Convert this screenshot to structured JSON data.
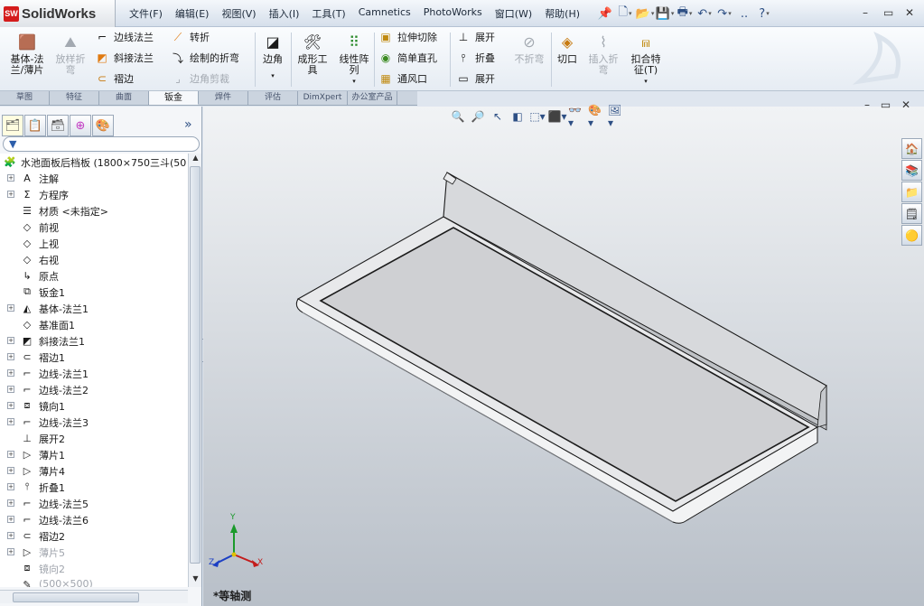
{
  "app": {
    "logo_mark": "SW",
    "logo_text": "SolidWorks"
  },
  "menu": [
    "文件(F)",
    "编辑(E)",
    "视图(V)",
    "插入(I)",
    "工具(T)",
    "Camnetics",
    "PhotoWorks",
    "窗口(W)",
    "帮助(H)"
  ],
  "quick_icons": [
    "pin-icon",
    "new-doc-icon",
    "open-folder-icon",
    "save-icon",
    "print-icon",
    "undo-icon",
    "redo-icon",
    "help-icon"
  ],
  "quick_help": "?",
  "quick_more": "..",
  "window_controls": {
    "minimize": "–",
    "restore": "▭",
    "close": "✕"
  },
  "ribbon": {
    "base_flange": "基体-法\n兰/薄片",
    "lofted_bend": "放样折\n弯",
    "edge_flange": "边线法兰",
    "miter_flange": "斜接法兰",
    "hem": "褶边",
    "jog": "转折",
    "sketched_bend": "绘制的折弯",
    "corner_trim": "边角剪裁",
    "corners": "边角",
    "forming_tool": "成形工\n具",
    "linear_pattern": "线性阵\n列",
    "extruded_cut": "拉伸切除",
    "simple_hole": "简单直孔",
    "vent": "通风口",
    "unfold": "展开",
    "fold": "折叠",
    "flatten": "展开",
    "no_bends": "不折弯",
    "rip": "切口",
    "insert_bends": "插入折\n弯",
    "tab_slot": "扣合特\n征(T)"
  },
  "tabs": [
    {
      "label": "草图",
      "active": false
    },
    {
      "label": "特征",
      "active": false
    },
    {
      "label": "曲面",
      "active": false
    },
    {
      "label": "钣金",
      "active": true
    },
    {
      "label": "焊件",
      "active": false
    },
    {
      "label": "评估",
      "active": false
    },
    {
      "label": "DimXpert",
      "active": false
    },
    {
      "label": "办公室产品",
      "active": false
    }
  ],
  "feature_manager": {
    "chevron": "»",
    "filter_icon": "filter-icon",
    "root": "水池面板后档板  (1800×750三斗(50",
    "nodes": [
      {
        "label": "注解",
        "expandable": true,
        "icon": "annotation-icon",
        "dim": false
      },
      {
        "label": "方程序",
        "expandable": true,
        "icon": "equation-icon",
        "dim": false
      },
      {
        "label": "材质 <未指定>",
        "expandable": false,
        "icon": "material-icon",
        "dim": false
      },
      {
        "label": "前视",
        "expandable": false,
        "icon": "plane-icon",
        "dim": false
      },
      {
        "label": "上视",
        "expandable": false,
        "icon": "plane-icon",
        "dim": false
      },
      {
        "label": "右视",
        "expandable": false,
        "icon": "plane-icon",
        "dim": false
      },
      {
        "label": "原点",
        "expandable": false,
        "icon": "origin-icon",
        "dim": false
      },
      {
        "label": "钣金1",
        "expandable": false,
        "icon": "sheetmetal-icon",
        "dim": false
      },
      {
        "label": "基体-法兰1",
        "expandable": true,
        "icon": "base-flange-icon",
        "dim": false
      },
      {
        "label": "基准面1",
        "expandable": false,
        "icon": "plane-icon",
        "dim": false
      },
      {
        "label": "斜接法兰1",
        "expandable": true,
        "icon": "miter-flange-icon",
        "dim": false
      },
      {
        "label": "褶边1",
        "expandable": true,
        "icon": "hem-icon",
        "dim": false
      },
      {
        "label": "边线-法兰1",
        "expandable": true,
        "icon": "edge-flange-icon",
        "dim": false
      },
      {
        "label": "边线-法兰2",
        "expandable": true,
        "icon": "edge-flange-icon",
        "dim": false
      },
      {
        "label": "镜向1",
        "expandable": true,
        "icon": "mirror-icon",
        "dim": false
      },
      {
        "label": "边线-法兰3",
        "expandable": true,
        "icon": "edge-flange-icon",
        "dim": false
      },
      {
        "label": "展开2",
        "expandable": false,
        "icon": "unfold-icon",
        "dim": false
      },
      {
        "label": "薄片1",
        "expandable": true,
        "icon": "tab-icon",
        "dim": false
      },
      {
        "label": "薄片4",
        "expandable": true,
        "icon": "tab-icon",
        "dim": false
      },
      {
        "label": "折叠1",
        "expandable": true,
        "icon": "fold-icon",
        "dim": false
      },
      {
        "label": "边线-法兰5",
        "expandable": true,
        "icon": "edge-flange-icon",
        "dim": false
      },
      {
        "label": "边线-法兰6",
        "expandable": true,
        "icon": "edge-flange-icon",
        "dim": false
      },
      {
        "label": "褶边2",
        "expandable": true,
        "icon": "hem-icon",
        "dim": false
      },
      {
        "label": "薄片5",
        "expandable": true,
        "icon": "tab-icon",
        "dim": true
      },
      {
        "label": "镜向2",
        "expandable": false,
        "icon": "mirror-icon",
        "dim": true
      },
      {
        "label": "(500×500)",
        "expandable": false,
        "icon": "sketch-icon",
        "dim": true
      }
    ]
  },
  "viewport": {
    "view_name": "*等轴测",
    "axes": {
      "x": "X",
      "y": "Y",
      "z": "Z"
    },
    "view_tool_icons": [
      "zoom-fit-icon",
      "zoom-area-icon",
      "previous-view-icon",
      "section-view-icon",
      "view-orientation-icon",
      "display-style-icon",
      "hide-show-icon",
      "edit-appearance-icon",
      "apply-scene-icon"
    ],
    "task_pane_icons": [
      "home-icon",
      "design-library-icon",
      "file-explorer-icon",
      "view-palette-icon",
      "appearances-icon"
    ]
  },
  "colors": {
    "titlebar": "#d5dfeb",
    "viewport_top": "#f1f3f5",
    "viewport_bottom": "#b8bfc8",
    "model_face": "#cfd0d3",
    "model_edge": "#1b1b1b",
    "brand_red": "#d41c1c"
  }
}
